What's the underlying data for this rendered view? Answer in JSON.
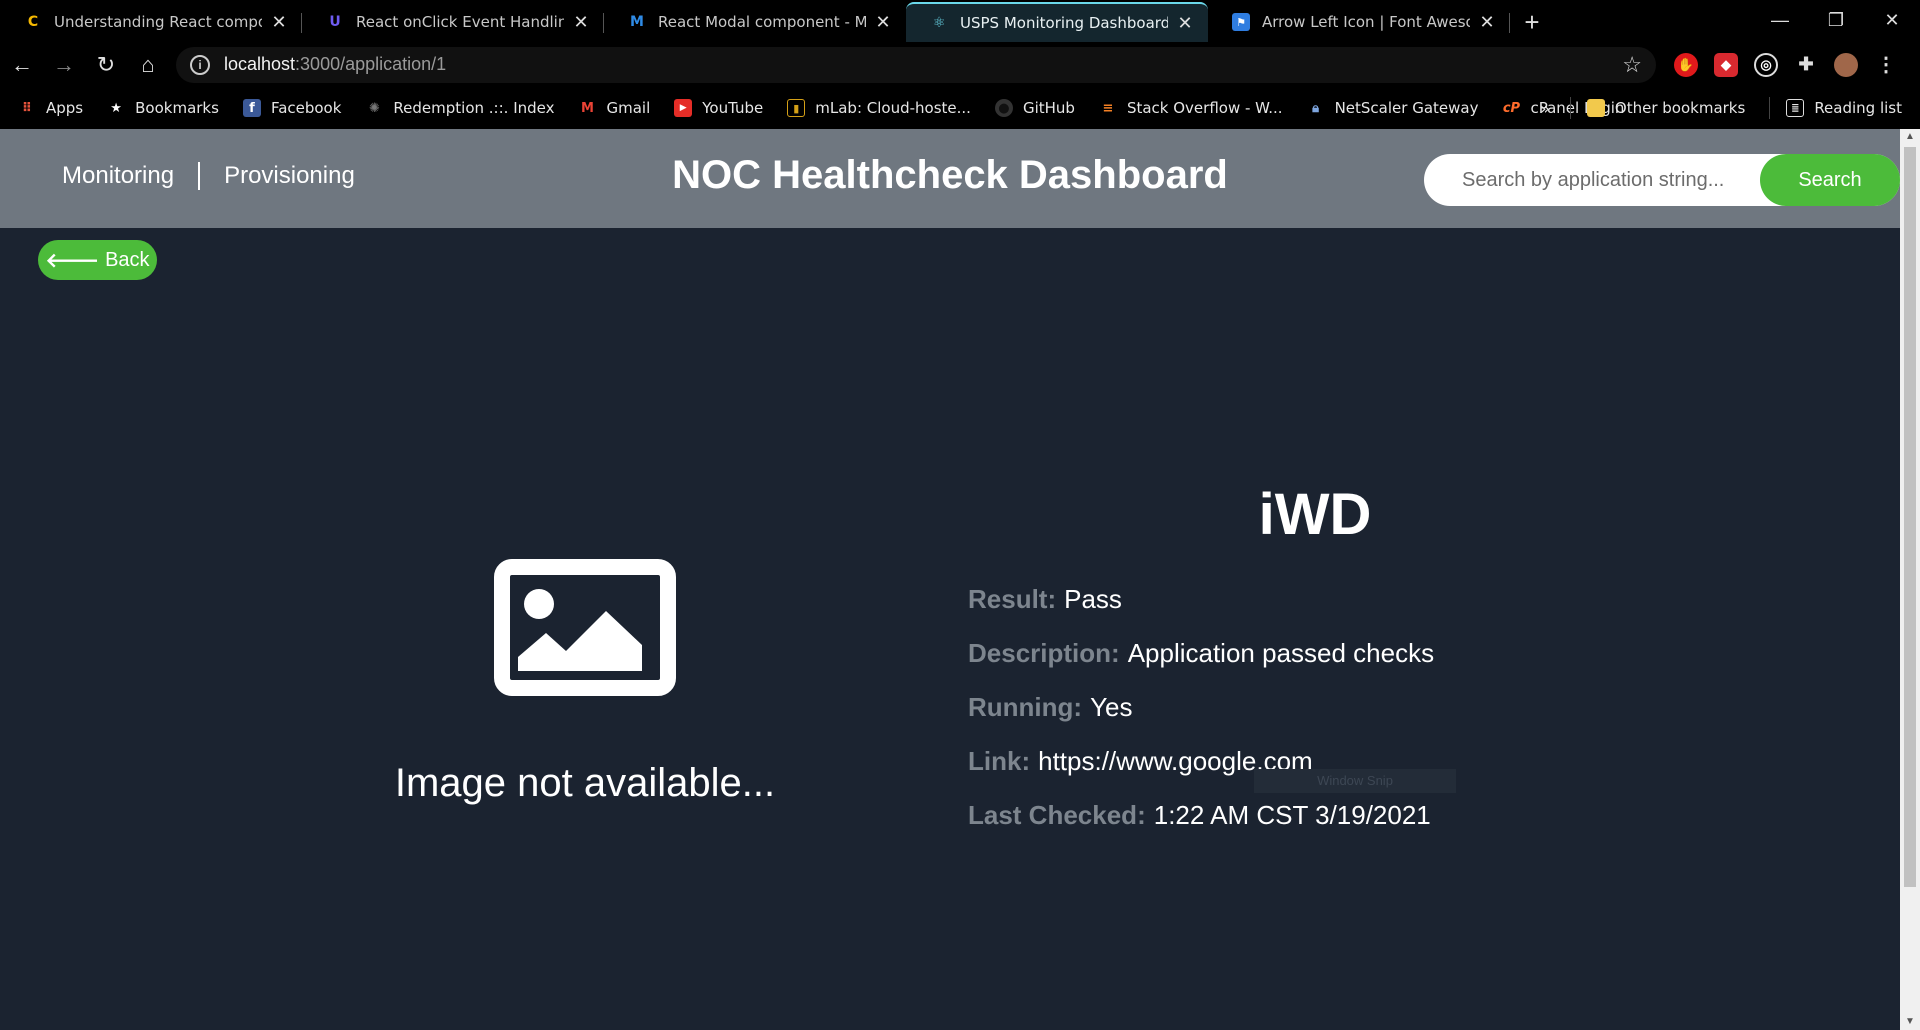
{
  "browser": {
    "tabs": [
      {
        "title": "Understanding React component",
        "icon": "loading-spinner-icon",
        "active": false
      },
      {
        "title": "React onClick Event Handling (W",
        "icon": "brand-u-icon",
        "active": false
      },
      {
        "title": "React Modal component - Mater",
        "icon": "mui-logo-icon",
        "active": false
      },
      {
        "title": "USPS Monitoring Dashboard",
        "icon": "react-atom-icon",
        "active": true
      },
      {
        "title": "Arrow Left Icon | Font Awesome",
        "icon": "flag-icon",
        "active": false
      }
    ],
    "address": {
      "host": "localhost",
      "path": ":3000/application/1"
    },
    "bookmarks": [
      {
        "label": "Apps",
        "icon": "apps-grid-icon"
      },
      {
        "label": "Bookmarks",
        "icon": "star-icon"
      },
      {
        "label": "Facebook",
        "icon": "facebook-icon"
      },
      {
        "label": "Redemption .::. Index",
        "icon": "redemption-icon"
      },
      {
        "label": "Gmail",
        "icon": "gmail-icon"
      },
      {
        "label": "YouTube",
        "icon": "youtube-icon"
      },
      {
        "label": "mLab: Cloud-hoste...",
        "icon": "mlab-icon"
      },
      {
        "label": "GitHub",
        "icon": "github-icon"
      },
      {
        "label": "Stack Overflow - W...",
        "icon": "stackoverflow-icon"
      },
      {
        "label": "NetScaler Gateway",
        "icon": "lock-icon"
      },
      {
        "label": "cPanel Login",
        "icon": "cpanel-icon"
      }
    ],
    "other_bookmarks": "Other bookmarks",
    "reading_list": "Reading list",
    "overflow": "»"
  },
  "header": {
    "nav": [
      "Monitoring",
      "Provisioning"
    ],
    "title": "NOC Healthcheck Dashboard",
    "search_placeholder": "Search by application string...",
    "search_button": "Search"
  },
  "back_button": "Back",
  "image_placeholder_text": "Image not available...",
  "application": {
    "name": "iWD",
    "fields": [
      {
        "label": "Result:",
        "value": "Pass"
      },
      {
        "label": "Description:",
        "value": "Application passed checks"
      },
      {
        "label": "Running:",
        "value": "Yes"
      },
      {
        "label": "Link:",
        "value": "https://www.google.com"
      },
      {
        "label": "Last Checked:",
        "value": "1:22 AM CST 3/19/2021"
      }
    ]
  },
  "overlay_text": "Window Snip",
  "colors": {
    "accent_green": "#4cbb3a",
    "header_gray": "#6f7780",
    "page_bg": "#1b2330",
    "label_gray": "#7d858e"
  }
}
